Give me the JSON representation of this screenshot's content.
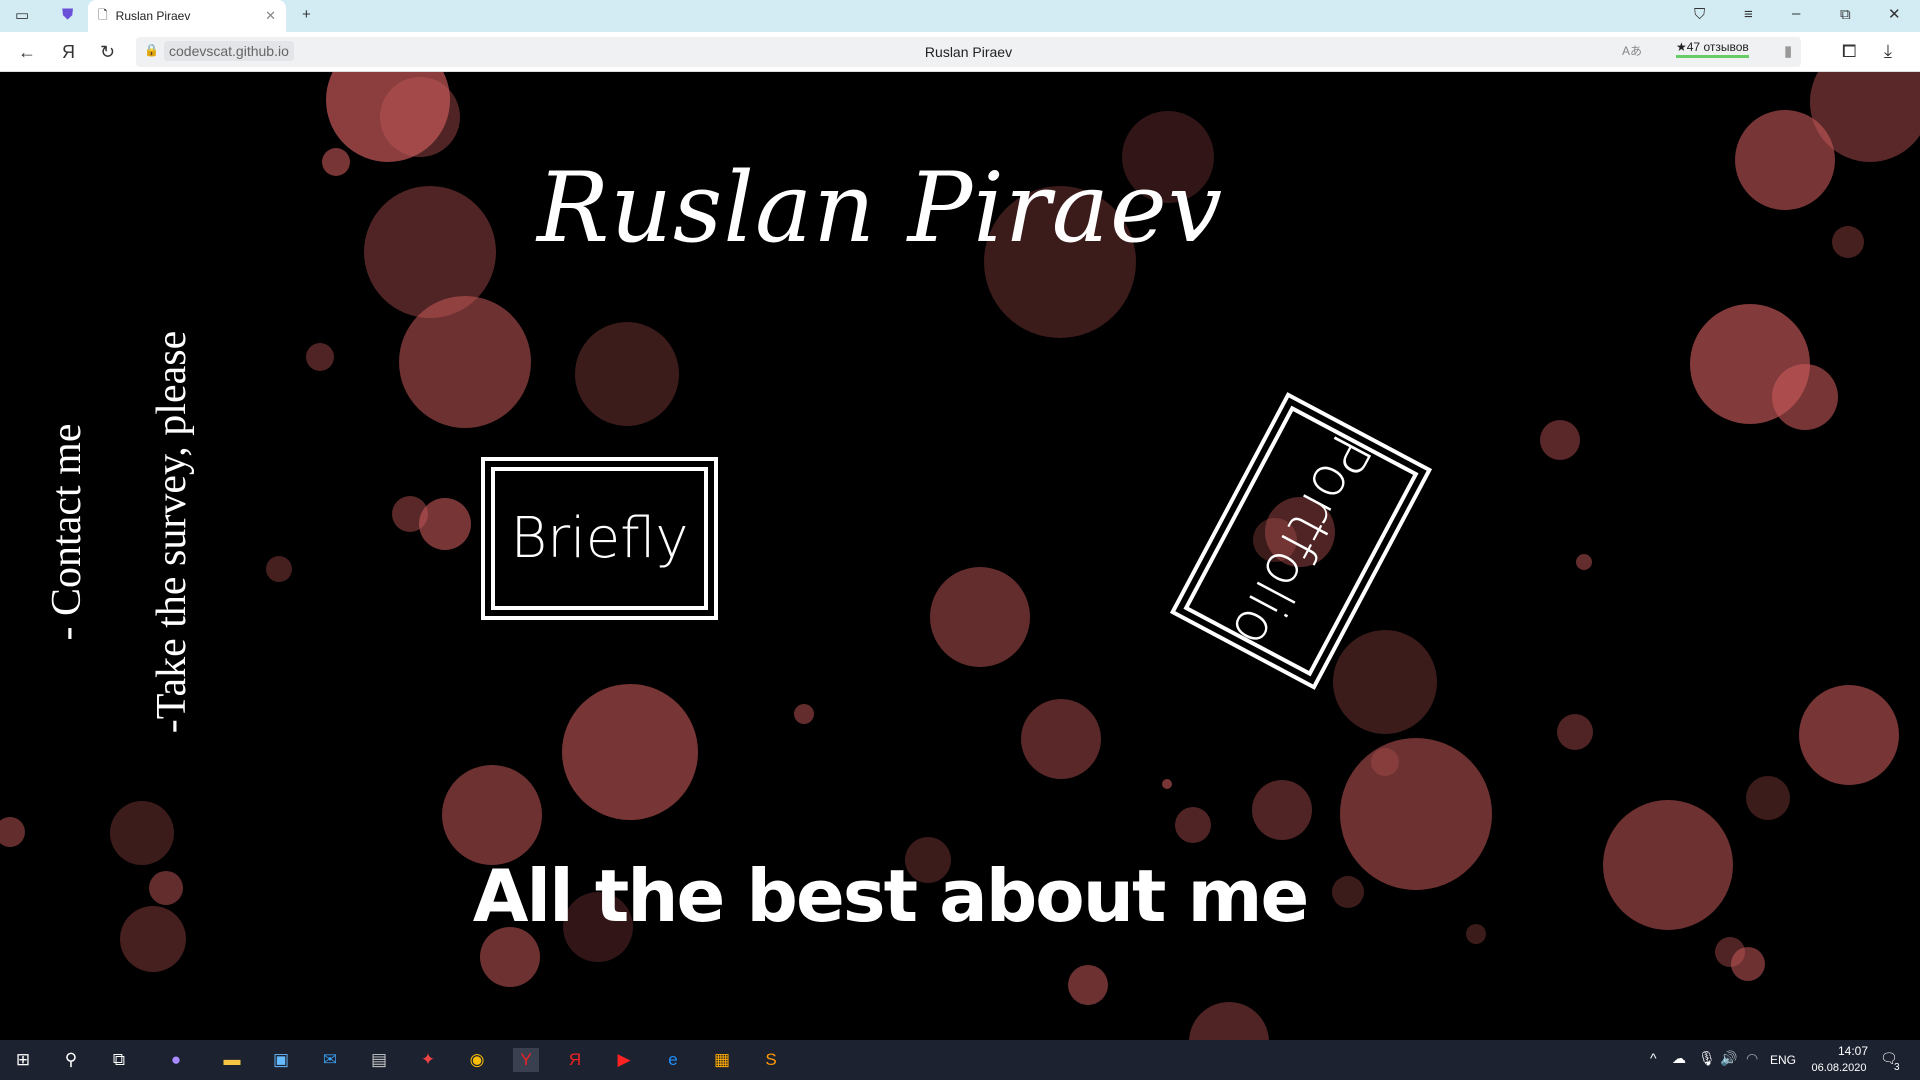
{
  "browser": {
    "tab_title": "Ruslan Piraev",
    "url": "codevscat.github.io",
    "page_title": "Ruslan Piraev",
    "reviews": "★47 отзывов"
  },
  "page": {
    "title": "Ruslan Piraev",
    "briefly": "Briefly",
    "portfolio": "Portfolio",
    "contact": "- Contact me",
    "survey": "-Take the survey, please",
    "tagline": "All the best about me"
  },
  "taskbar": {
    "lang": "ENG",
    "time": "14:07",
    "date": "06.08.2020",
    "notifications": "3"
  },
  "colors": {
    "bubble": "#c8595a",
    "background": "#000000"
  }
}
